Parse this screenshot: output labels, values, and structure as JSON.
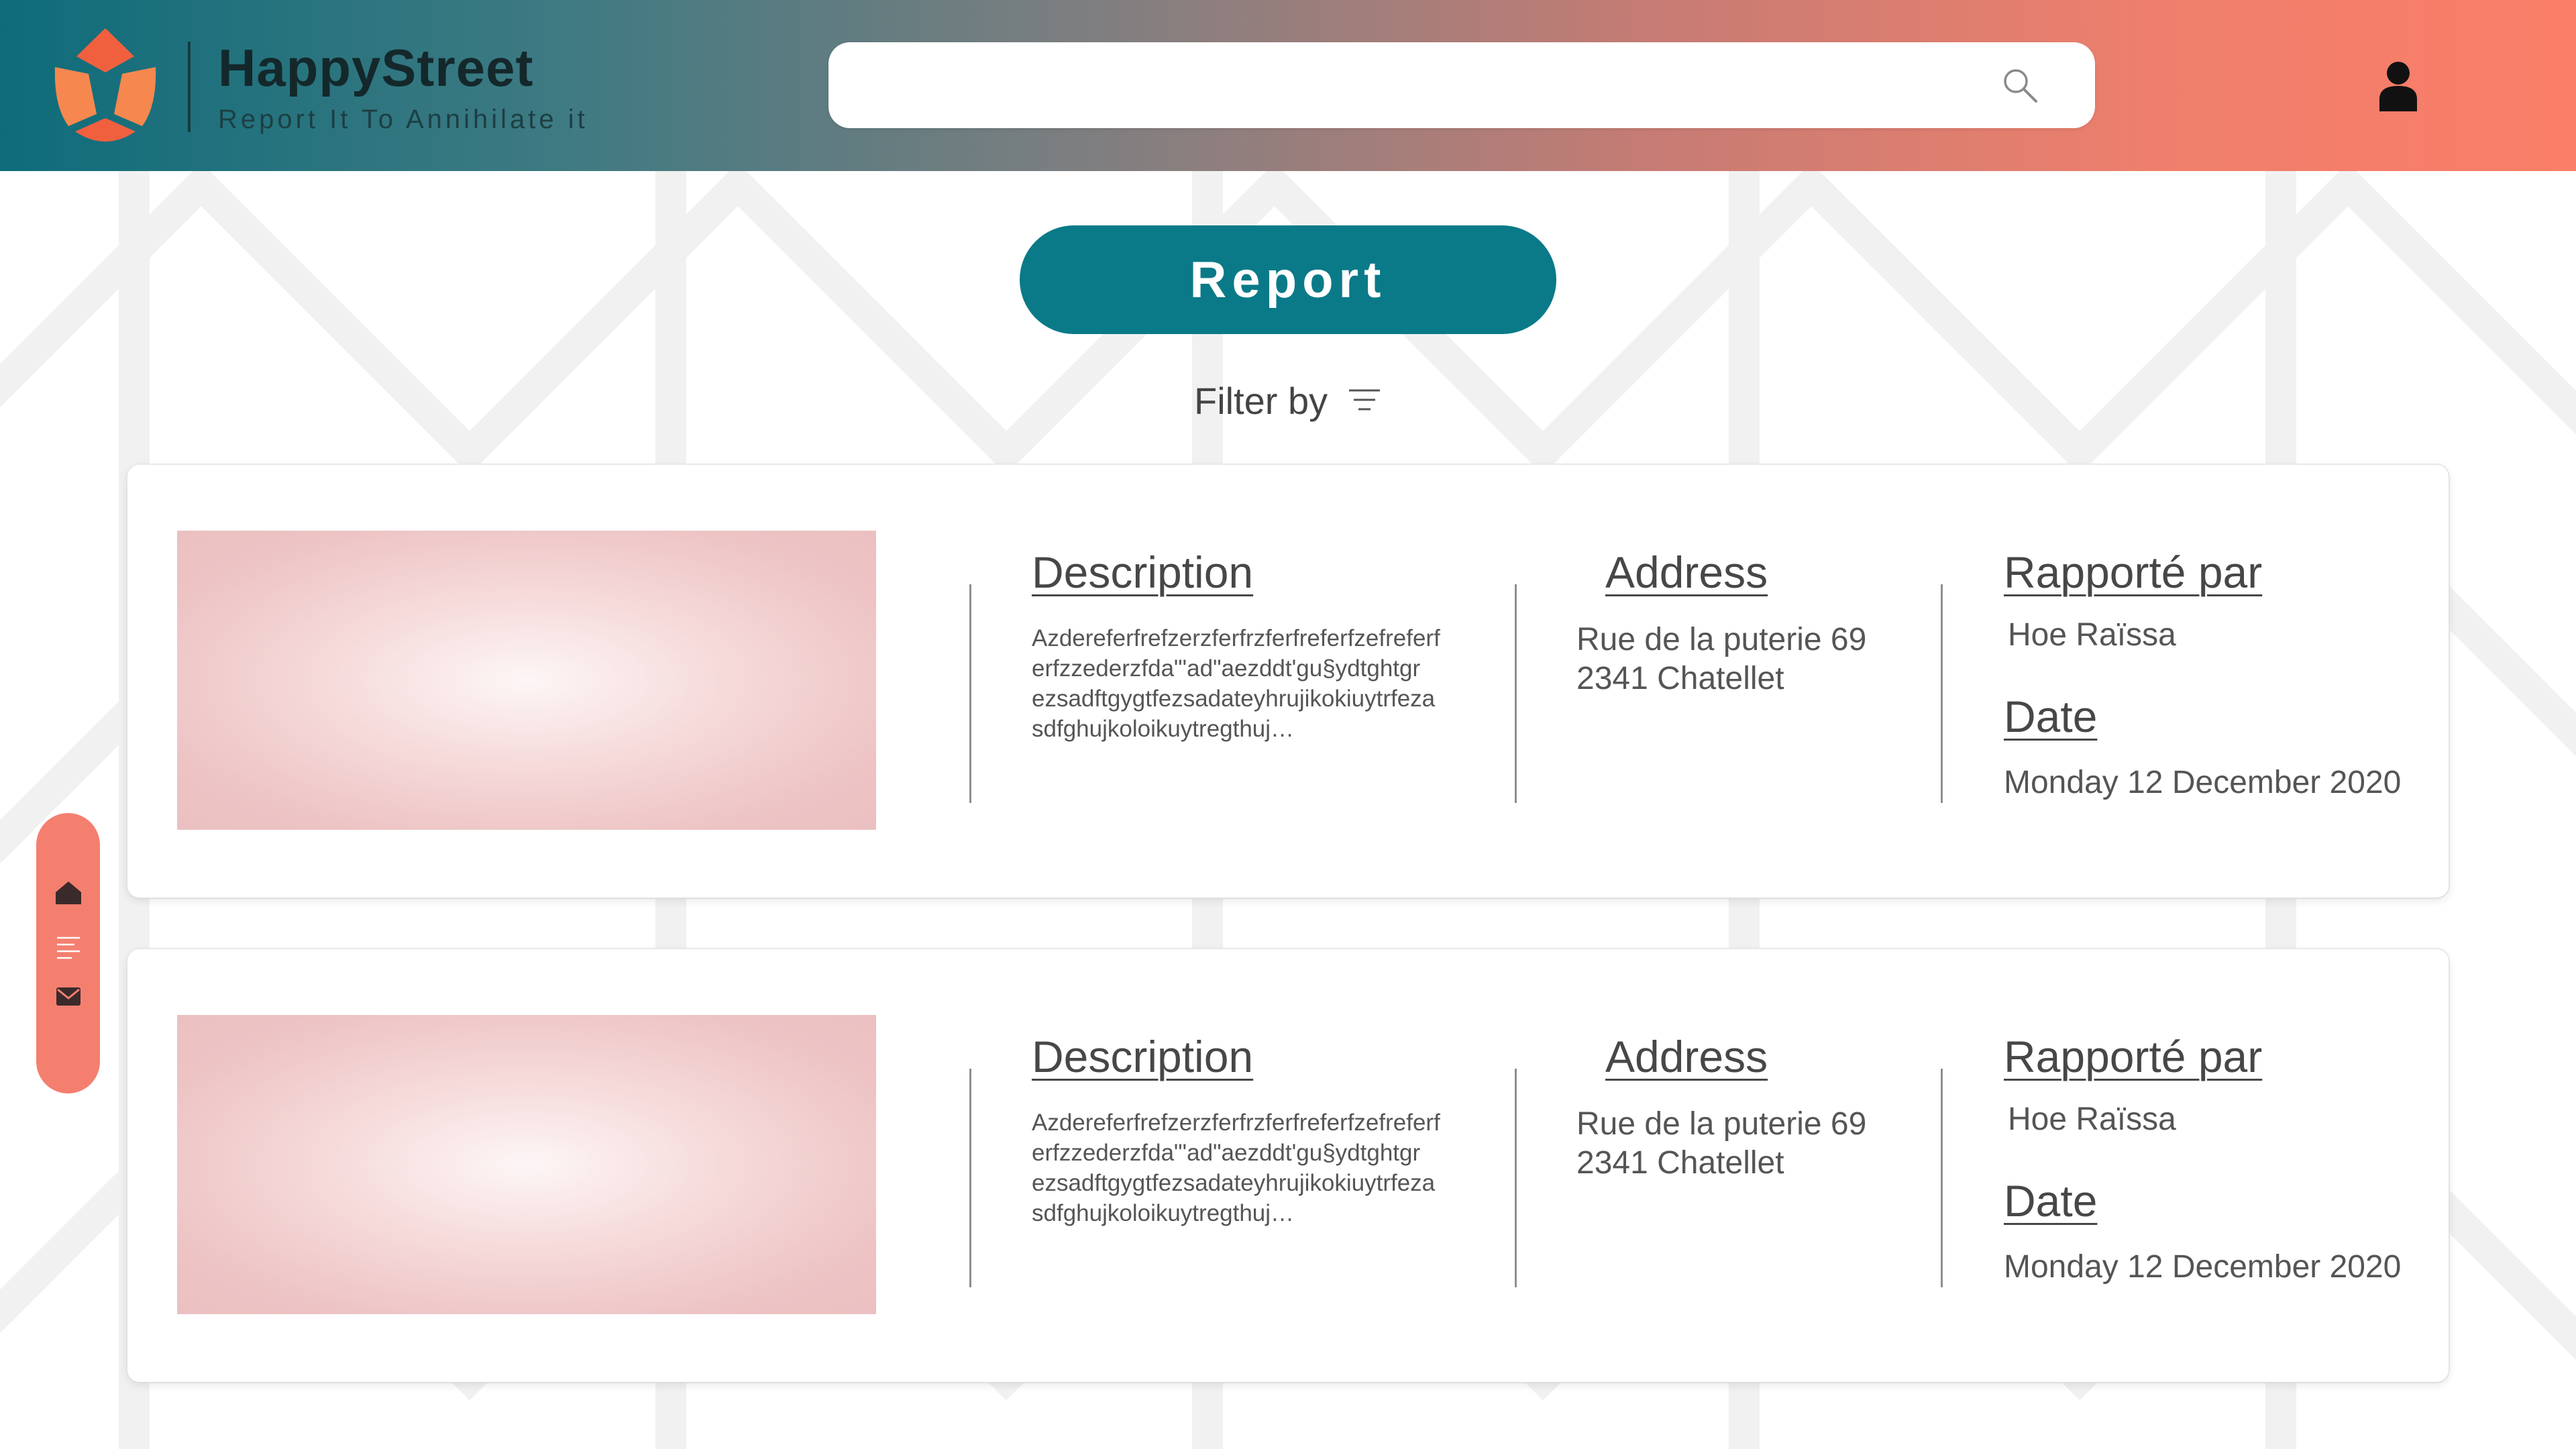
{
  "header": {
    "brand_name": "HappyStreet",
    "tagline": "Report It To Annihilate it",
    "search": {
      "value": "",
      "placeholder": ""
    },
    "colors": {
      "gradient_start": "#0e6c7a",
      "gradient_end": "#fa7e68"
    },
    "icons": {
      "search": "search-icon",
      "user": "user-icon"
    }
  },
  "actions": {
    "report_label": "Report",
    "filter_label": "Filter by",
    "report_color": "#0a7a88"
  },
  "side_nav": {
    "color": "#f47f6f",
    "items": [
      {
        "icon": "home-icon"
      },
      {
        "icon": "list-icon"
      },
      {
        "icon": "mail-icon"
      }
    ]
  },
  "reports": [
    {
      "description_heading": "Description",
      "description": "Azdereferfrefzerzferfrzferfreferfzefreferf\nerfzzederzfda\"'ad\"aezddt'gu§ydtghtgr\nezsadftgygtfezsadateyhrujikokiuytrfeza\nsdfghujkoloikuytregthuj…",
      "address_heading": "Address",
      "address_line1": "Rue de la puterie 69",
      "address_line2": "2341 Chatellet",
      "reported_by_heading": "Rapporté par",
      "reported_by": "Hoe Raïssa",
      "date_heading": "Date",
      "date": "Monday 12 December 2020"
    },
    {
      "description_heading": "Description",
      "description": "Azdereferfrefzerzferfrzferfreferfzefreferf\nerfzzederzfda\"'ad\"aezddt'gu§ydtghtgr\nezsadftgygtfezsadateyhrujikokiuytrfeza\nsdfghujkoloikuytregthuj…",
      "address_heading": "Address",
      "address_line1": "Rue de la puterie 69",
      "address_line2": "2341 Chatellet",
      "reported_by_heading": "Rapporté par",
      "reported_by": "Hoe Raïssa",
      "date_heading": "Date",
      "date": "Monday 12 December 2020"
    }
  ]
}
